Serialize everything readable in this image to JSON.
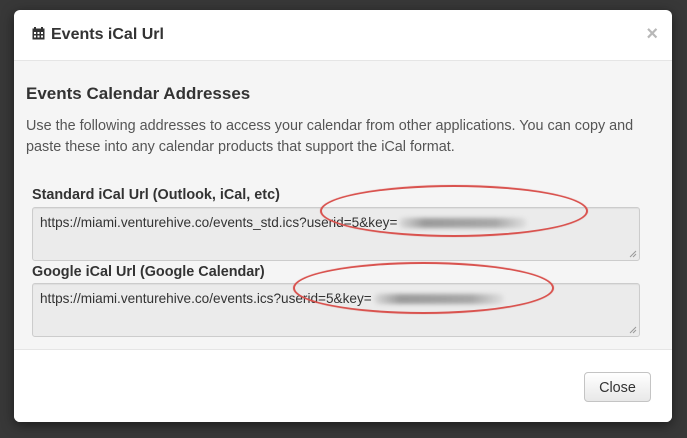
{
  "modal": {
    "title": "Events iCal Url",
    "close_glyph": "×",
    "icon": "calendar-icon"
  },
  "body": {
    "heading": "Events Calendar Addresses",
    "description": "Use the following addresses to access your calendar from other applications. You can copy and paste these into any calendar products that support the iCal format.",
    "fields": [
      {
        "label": "Standard iCal Url (Outlook, iCal, etc)",
        "value": "https://miami.venturehive.co/events_std.ics?userid=5&key="
      },
      {
        "label": "Google iCal Url (Google Calendar)",
        "value": "https://miami.venturehive.co/events.ics?userid=5&key="
      }
    ]
  },
  "footer": {
    "close_label": "Close"
  },
  "colors": {
    "annotation": "#d9534f",
    "backdrop": "#3c3c3c"
  }
}
